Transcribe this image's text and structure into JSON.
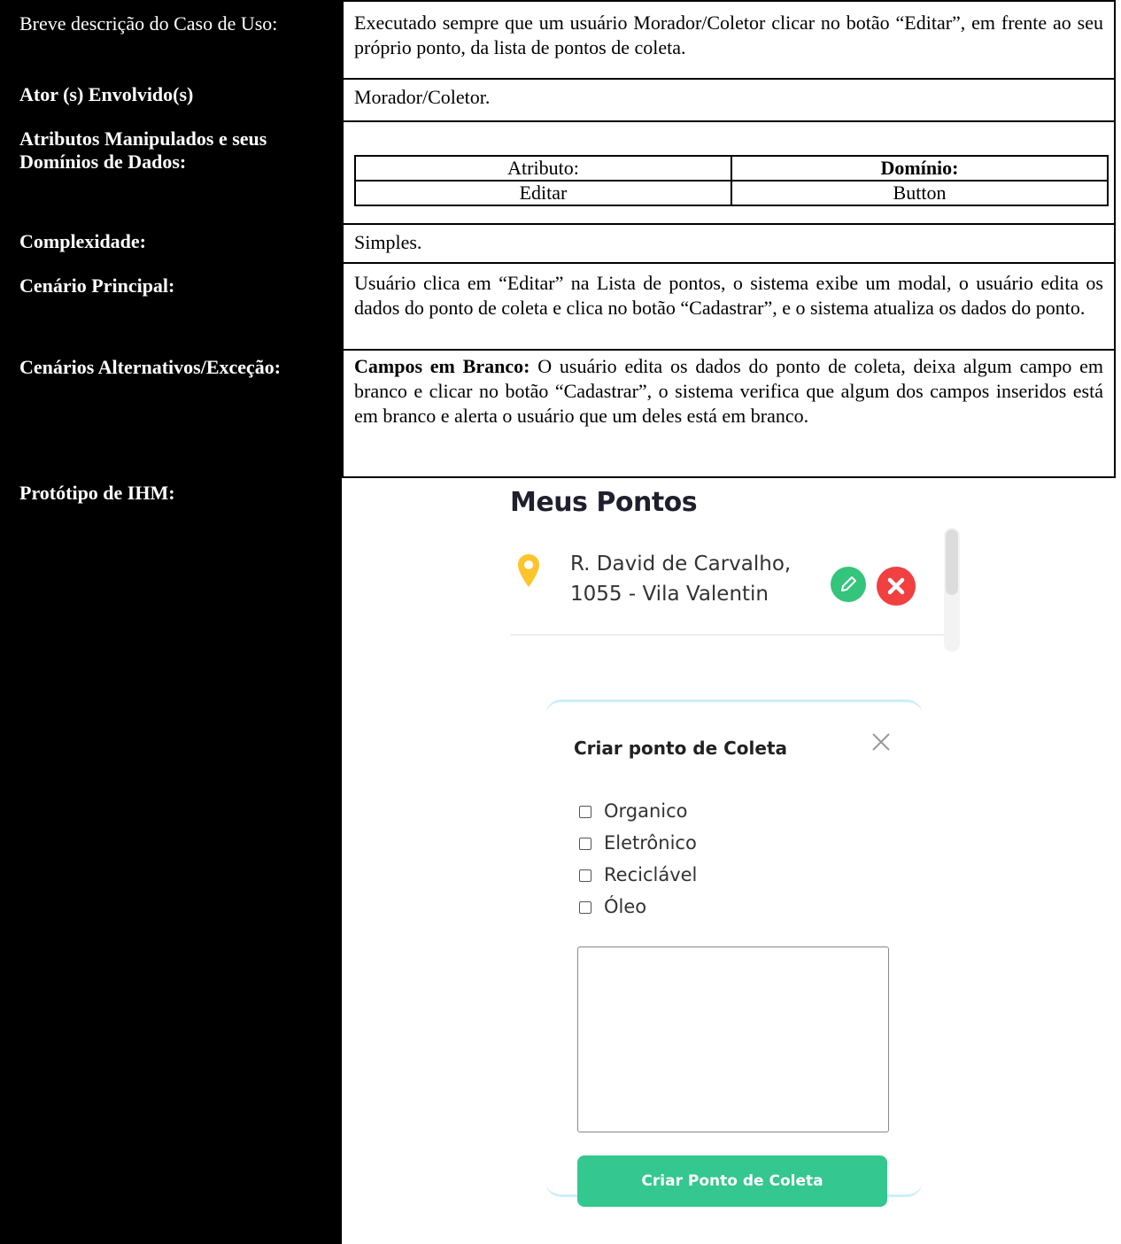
{
  "rows": {
    "descricao": {
      "label": "Breve descrição do Caso de Uso:",
      "value": "Executado sempre que um usuário Morador/Coletor clicar no botão “Editar”, em frente ao seu próprio ponto, da lista de pontos de coleta."
    },
    "ator": {
      "label": "Ator (s) Envolvido(s)",
      "value": "Morador/Coletor."
    },
    "atributos": {
      "label": "Atributos Manipulados e seus Domínios de Dados:",
      "header_attr": "Atributo:",
      "header_dom": "Domínio:",
      "row_attr": "Editar",
      "row_dom": "Button"
    },
    "complexidade": {
      "label": "Complexidade:",
      "value": "Simples."
    },
    "cenario_principal": {
      "label": "Cenário Principal:",
      "value": "Usuário clica em “Editar” na Lista de pontos, o sistema exibe um modal, o usuário edita os dados do ponto de coleta e clica no botão “Cadastrar”, e o sistema atualiza os dados do ponto."
    },
    "cenarios_alt": {
      "label": "Cenários Alternativos/Exceção:",
      "value_bold": "Campos em Branco:",
      "value": " O usuário edita os dados do ponto de coleta, deixa algum campo em branco e clicar no botão “Cadastrar”, o sistema verifica que algum dos campos inseridos está em branco e alerta o usuário que um deles está em branco."
    },
    "prototipo": {
      "label": "Protótipo de IHM:"
    }
  },
  "prototype": {
    "list_title": "Meus Pontos",
    "address_line1": "R. David de Carvalho,",
    "address_line2": "1055 - Vila Valentin",
    "modal_title": "Criar ponto de Coleta",
    "checkboxes": [
      "Organico",
      "Eletrônico",
      "Reciclável",
      "Óleo"
    ],
    "create_button": "Criar Ponto de Coleta",
    "colors": {
      "green": "#34c78f",
      "red": "#f04040",
      "pin": "#fcc52a"
    }
  }
}
